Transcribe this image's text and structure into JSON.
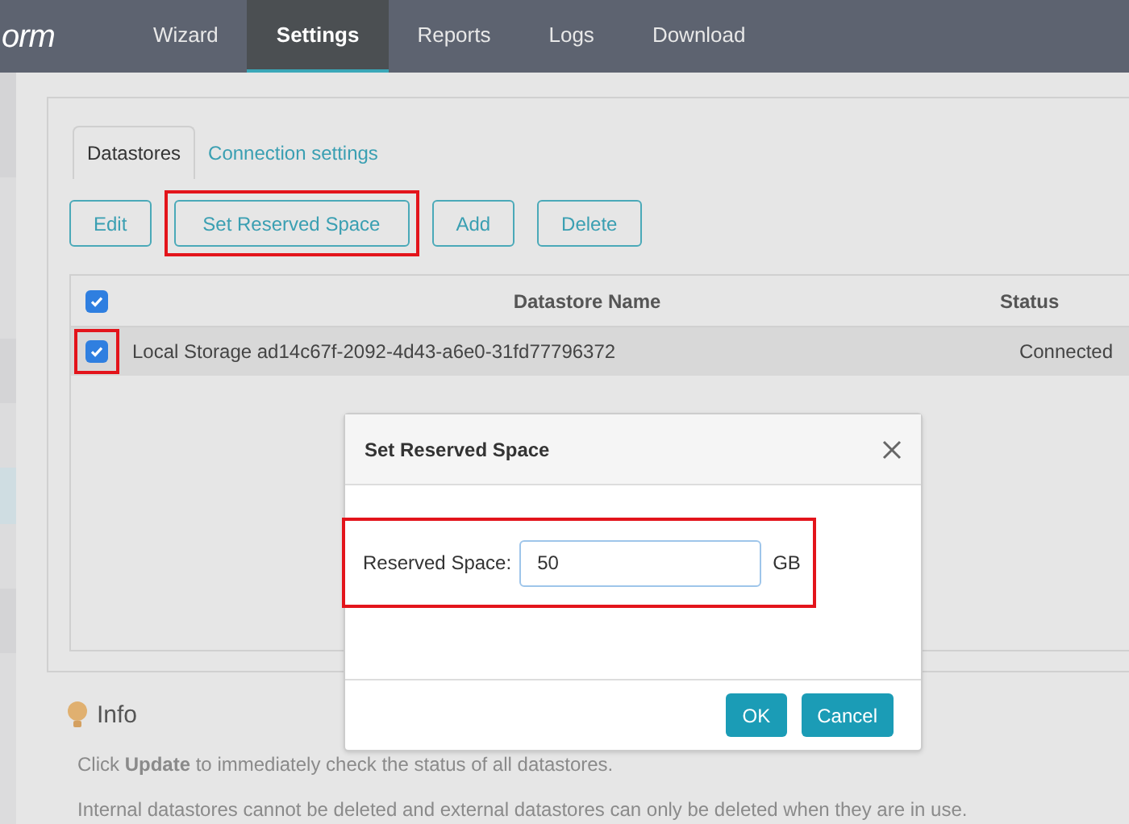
{
  "logo": "orm",
  "nav": [
    {
      "label": "Wizard",
      "selected": false
    },
    {
      "label": "Settings",
      "selected": true
    },
    {
      "label": "Reports",
      "selected": false
    },
    {
      "label": "Logs",
      "selected": false
    },
    {
      "label": "Download",
      "selected": false
    }
  ],
  "tabs": [
    {
      "label": "Datastores",
      "selected": true
    },
    {
      "label": "Connection settings",
      "selected": false
    }
  ],
  "toolbar": [
    {
      "label": "Edit",
      "highlighted": false
    },
    {
      "label": "Set Reserved Space",
      "highlighted": true
    },
    {
      "label": "Add",
      "highlighted": false
    },
    {
      "label": "Delete",
      "highlighted": false
    }
  ],
  "table": {
    "select_all": {
      "checked": true
    },
    "columns": [
      "Datastore Name",
      "Status"
    ],
    "rows": [
      {
        "checked": true,
        "highlighted": true,
        "name": "Local Storage ad14c67f-2092-4d43-a6e0-31fd77796372",
        "status": "Connected"
      }
    ]
  },
  "info": {
    "title": "Info",
    "lines": [
      "Click **Update** to immediately check the status of all datastores.",
      "Internal datastores cannot be deleted and external datastores can only be deleted when they are in use."
    ]
  },
  "dialog": {
    "title": "Set Reserved Space",
    "label": "Reserved Space:",
    "value": "50",
    "unit": "GB",
    "highlighted": true,
    "buttons": [
      "OK",
      "Cancel"
    ]
  }
}
